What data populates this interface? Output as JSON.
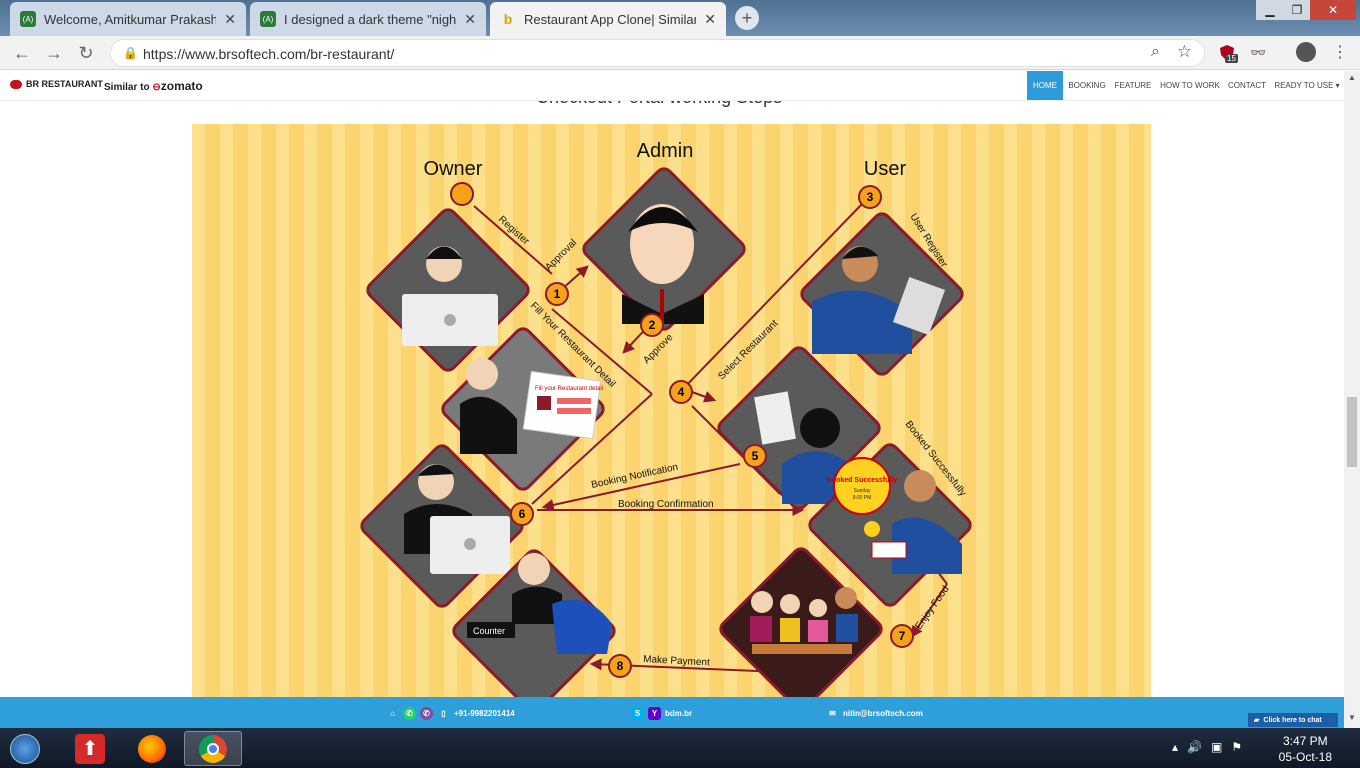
{
  "browser": {
    "tabs": [
      {
        "title": "Welcome, Amitkumar Prakash Ku",
        "favicon": "green-app-icon"
      },
      {
        "title": "I designed a dark theme \"night m",
        "favicon": "green-app-icon"
      },
      {
        "title": "Restaurant App Clone| Similar we",
        "favicon": "bing-icon",
        "active": true
      }
    ],
    "url": "https://www.brsoftech.com/br-restaurant/",
    "extension_badge": "15"
  },
  "site": {
    "logo_text": "BR RESTAURANT",
    "similar_to": "Similar to",
    "zomato": "zomato",
    "menu": [
      "HOME",
      "BOOKING",
      "FEATURE",
      "HOW TO WORK",
      "CONTACT",
      "READY TO USE ▾"
    ],
    "section_title": "Checkout Portal working Steps"
  },
  "diagram": {
    "roles": {
      "owner": "Owner",
      "admin": "Admin",
      "user": "User"
    },
    "steps": [
      "1",
      "2",
      "3",
      "4",
      "5",
      "6",
      "7",
      "8"
    ],
    "labels": {
      "register": "Register",
      "approval": "Approval",
      "approve": "Approve",
      "fill_detail": "Fill Your Restaurant Detail",
      "user_register": "User Register",
      "select_restaurant": "Select Restaurant",
      "booked_successfully": "Booked Successfully",
      "booking_notification": "Booking Notification",
      "booking_confirmation": "Booking Confirmation",
      "enjoy_food": "Enjoy Food",
      "make_payment": "Make Payment",
      "counter": "Counter",
      "bubble_title": "Booked Successfully",
      "bubble_day": "Sunday",
      "bubble_time": "8:00 PM",
      "form_heading": "Fill your Restaurant detail"
    },
    "colors": {
      "background": "#fbd46f",
      "frame": "#8b1a2b",
      "badge": "#f5a11a"
    }
  },
  "contact_bar": {
    "phone": "+91-9982201414",
    "skype": "bdm.br",
    "email": "nitin@brsoftech.com",
    "chat": "Click here to chat"
  },
  "taskbar": {
    "time": "3:47 PM",
    "date": "05-Oct-18"
  }
}
